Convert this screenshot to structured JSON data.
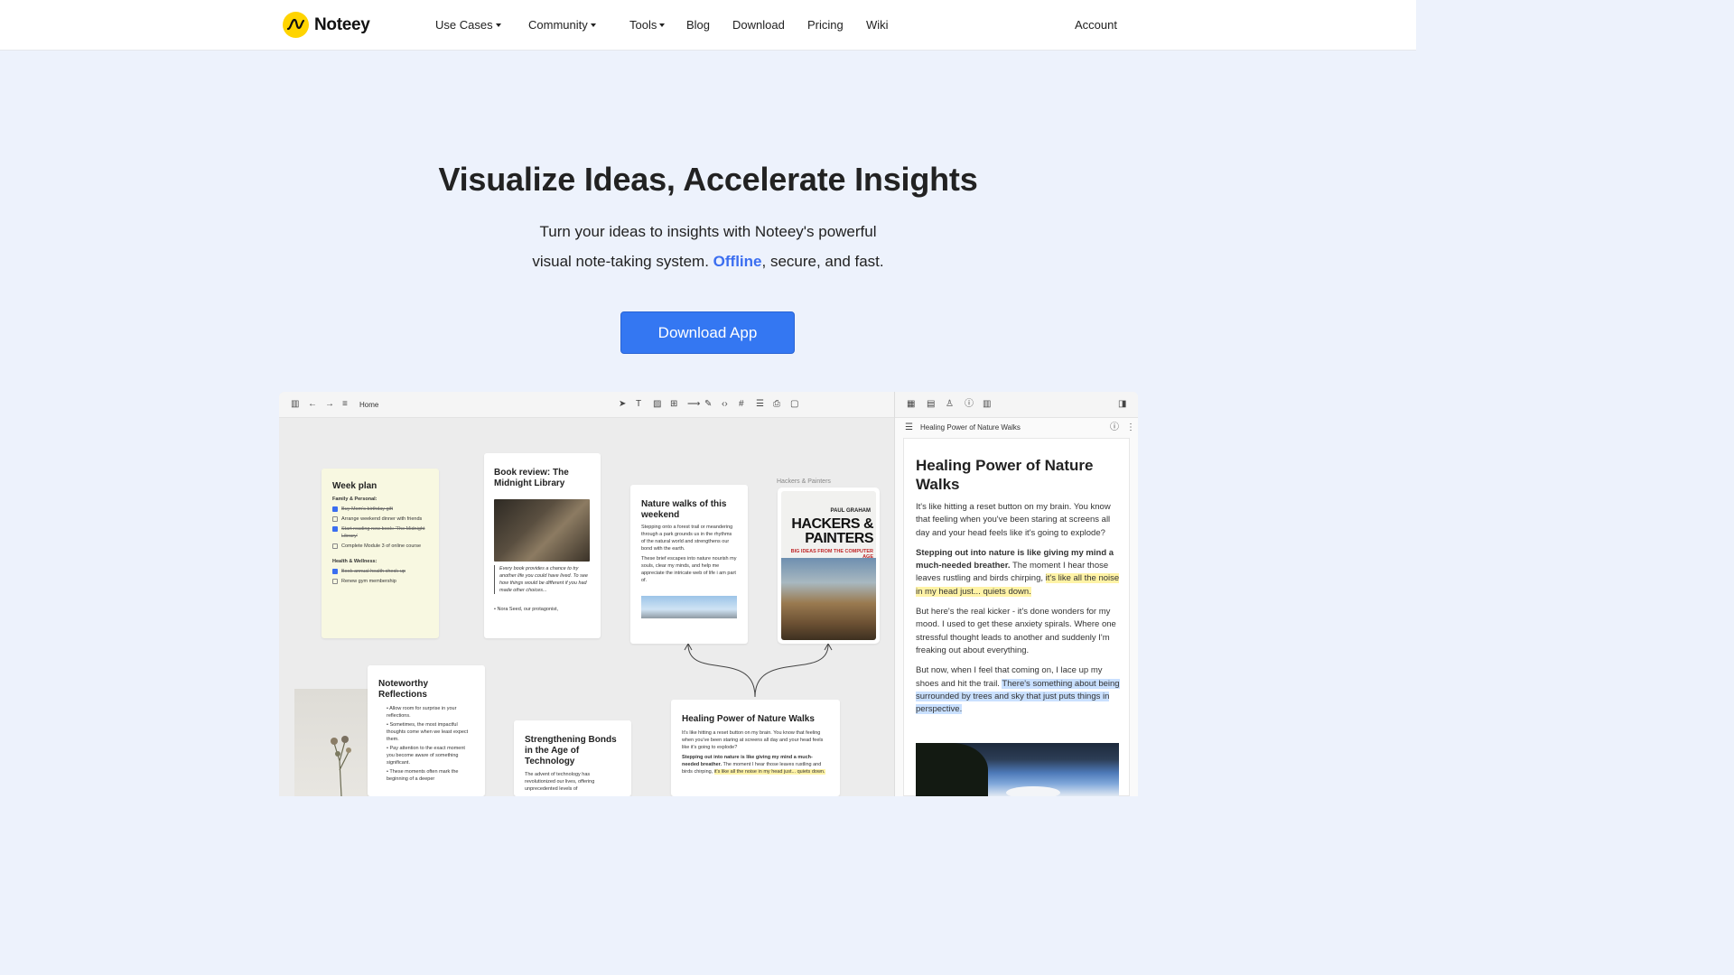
{
  "nav": {
    "logo_text": "Noteey",
    "items": [
      {
        "label": "Use Cases",
        "dropdown": true
      },
      {
        "label": "Community",
        "dropdown": true
      },
      {
        "label": "Tools",
        "dropdown": true
      },
      {
        "label": "Blog",
        "dropdown": false
      },
      {
        "label": "Download",
        "dropdown": false
      },
      {
        "label": "Pricing",
        "dropdown": false
      },
      {
        "label": "Wiki",
        "dropdown": false
      }
    ],
    "account": "Account"
  },
  "hero": {
    "title": "Visualize Ideas, Accelerate Insights",
    "sub_line1": "Turn your ideas to insights with Noteey's powerful",
    "sub_line2_a": "visual note-taking system. ",
    "sub_line2_accent": "Offline",
    "sub_line2_b": ", secure, and fast.",
    "cta": "Download App"
  },
  "colors": {
    "accent": "#3b6ef0",
    "cta": "#3477f2",
    "logo": "#ffd400",
    "background": "#edf2fc"
  },
  "app": {
    "breadcrumb": "Home",
    "week_plan": {
      "title": "Week plan",
      "section1": "Family & Personal:",
      "items1": [
        {
          "text": "Buy Mom's birthday gift",
          "done": true
        },
        {
          "text": "Arrange weekend dinner with friends",
          "done": false
        },
        {
          "text": "Start reading new book: 'The Midnight Library'",
          "done": true
        },
        {
          "text": "Complete Module 3 of online course",
          "done": false
        }
      ],
      "section2": "Health & Wellness:",
      "items2": [
        {
          "text": "Book annual health check-up",
          "done": true
        },
        {
          "text": "Renew gym membership",
          "done": false
        }
      ]
    },
    "book_review": {
      "title": "Book review: The Midnight Library",
      "quote": "Every book provides a chance to try another life you could have lived. To see how things would be different if you had made other choices...",
      "bullet": "Nora Seed, our protagonist,"
    },
    "nature": {
      "title": "Nature walks of this weekend",
      "p1": "Stepping onto a forest trail or meandering through a park grounds us in the rhythms of the natural world and strengthens our bond with the earth.",
      "p2": "These brief escapes into nature nourish my souls, clear my minds, and help me appreciate the intricate web of life i am part of."
    },
    "hackers": {
      "label": "Hackers & Painters",
      "author": "PAUL GRAHAM",
      "title1": "HACKERS &",
      "title2": "PAINTERS",
      "subtitle": "BIG IDEAS FROM THE COMPUTER AGE"
    },
    "reflections": {
      "title": "Noteworthy Reflections",
      "items": [
        "Allow room for surprise in your reflections.",
        "Sometimes, the most impactful thoughts come when we least expect them.",
        "Pay attention to the exact moment you become aware of something significant.",
        "These moments often mark the beginning of a deeper"
      ]
    },
    "bonds": {
      "title": "Strengthening Bonds in the Age of Technology",
      "p": "The advent of technology has revolutionized our lives, offering unprecedented levels of"
    },
    "healing_card": {
      "title": "Healing Power of Nature Walks",
      "p1": "It's like hitting a reset button on my brain. You know that feeling when you've been staring at screens all day and your head feels like it's going to explode?",
      "p2_bold": "Stepping out into nature is like giving my mind a much-needed breather.",
      "p2_a": " The moment I hear those leaves rustling and birds chirping, ",
      "p2_hl": "it's like all the noise in my head just... quiets down."
    },
    "side": {
      "doc_tab": "Healing Power of Nature Walks",
      "heading": "Healing Power of Nature Walks",
      "p1": "It's like hitting a reset button on my brain. You know that feeling when you've been staring at screens all day and your head feels like it's going to explode?",
      "p2_bold": "Stepping out into nature is like giving my mind a much-needed breather.",
      "p2_a": " The moment I hear those leaves rustling and birds chirping, ",
      "p2_hl": "it's like all the noise in my head just... quiets down.",
      "p3": "But here's the real kicker - it's done wonders for my mood. I used to get these anxiety spirals. Where one stressful thought leads to another and suddenly I'm freaking out about everything.",
      "p4_a": "But now, when I feel that coming on, I lace up my shoes and hit the trail. ",
      "p4_hl": "There's something about being surrounded by trees and sky that just puts things in perspective."
    }
  }
}
